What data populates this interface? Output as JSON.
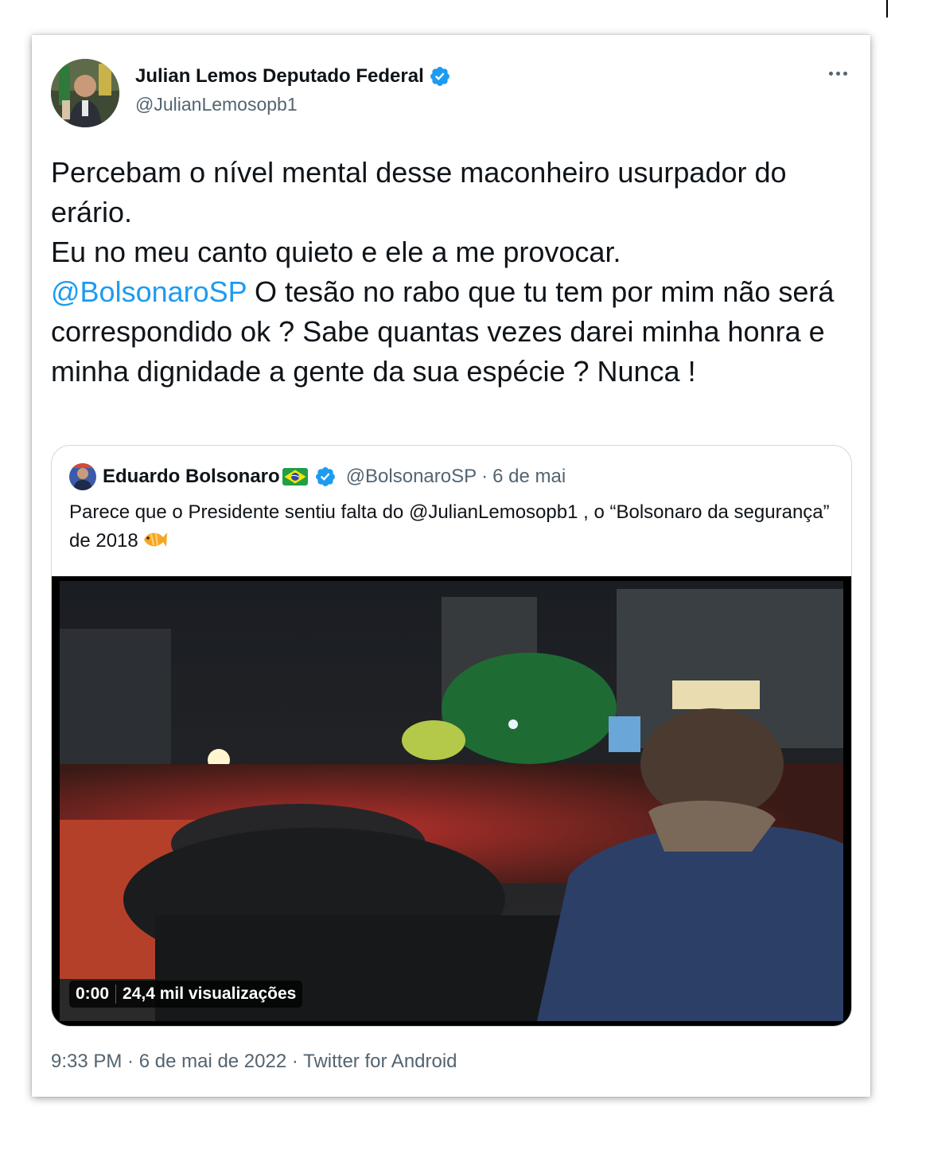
{
  "author": {
    "name": "Julian Lemos Deputado Federal",
    "handle": "@JulianLemosopb1"
  },
  "tweet": {
    "text_before": "Percebam o nível mental desse maconheiro usurpador do erário.\nEu no meu canto quieto e ele a me provocar.\n",
    "mention": "@BolsonaroSP",
    "text_after": " O tesão no rabo que tu tem por mim não será correspondido ok ? Sabe quantas vezes darei minha honra e minha dignidade a gente da sua espécie ? Nunca !"
  },
  "quoted": {
    "name": "Eduardo Bolsonaro",
    "handle": "@BolsonaroSP",
    "separator": "·",
    "date": "6 de mai",
    "text": "Parece que o Presidente sentiu falta do @JulianLemosopb1 , o “Bolsonaro da segurança” de 2018",
    "video": {
      "time": "0:00",
      "views": "24,4 mil visualizações"
    }
  },
  "footer": {
    "time": "9:33 PM",
    "separator": " · ",
    "date": "6 de mai de 2022",
    "source": "Twitter for Android"
  },
  "colors": {
    "accent": "#1d9bf0",
    "secondary_text": "#536471",
    "border": "#cfd9de"
  },
  "icons": [
    "verified-badge-icon",
    "more-options-icon",
    "brazil-flag-icon",
    "fish-emoji-icon"
  ]
}
